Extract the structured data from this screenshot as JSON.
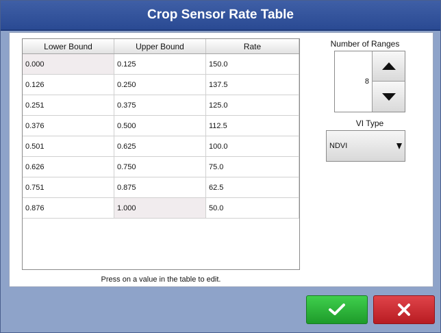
{
  "window": {
    "title": "Crop Sensor Rate Table"
  },
  "table": {
    "columns": [
      "Lower Bound",
      "Upper Bound",
      "Rate"
    ],
    "rows": [
      [
        "0.000",
        "0.125",
        "150.0"
      ],
      [
        "0.126",
        "0.250",
        "137.5"
      ],
      [
        "0.251",
        "0.375",
        "125.0"
      ],
      [
        "0.376",
        "0.500",
        "112.5"
      ],
      [
        "0.501",
        "0.625",
        "100.0"
      ],
      [
        "0.626",
        "0.750",
        "75.0"
      ],
      [
        "0.751",
        "0.875",
        "62.5"
      ],
      [
        "0.876",
        "1.000",
        "50.0"
      ]
    ]
  },
  "helper_text": "Press on a value in the table to edit.",
  "ranges": {
    "label": "Number of Ranges",
    "value": "8"
  },
  "vi_type": {
    "label": "VI Type",
    "selected": "NDVI"
  },
  "buttons": {
    "confirm_icon": "checkmark-icon",
    "cancel_icon": "x-icon"
  },
  "colors": {
    "title_bar": "#2f4f9a",
    "frame": "#8ea3c9",
    "confirm": "#2bb539",
    "cancel": "#d0282e"
  }
}
